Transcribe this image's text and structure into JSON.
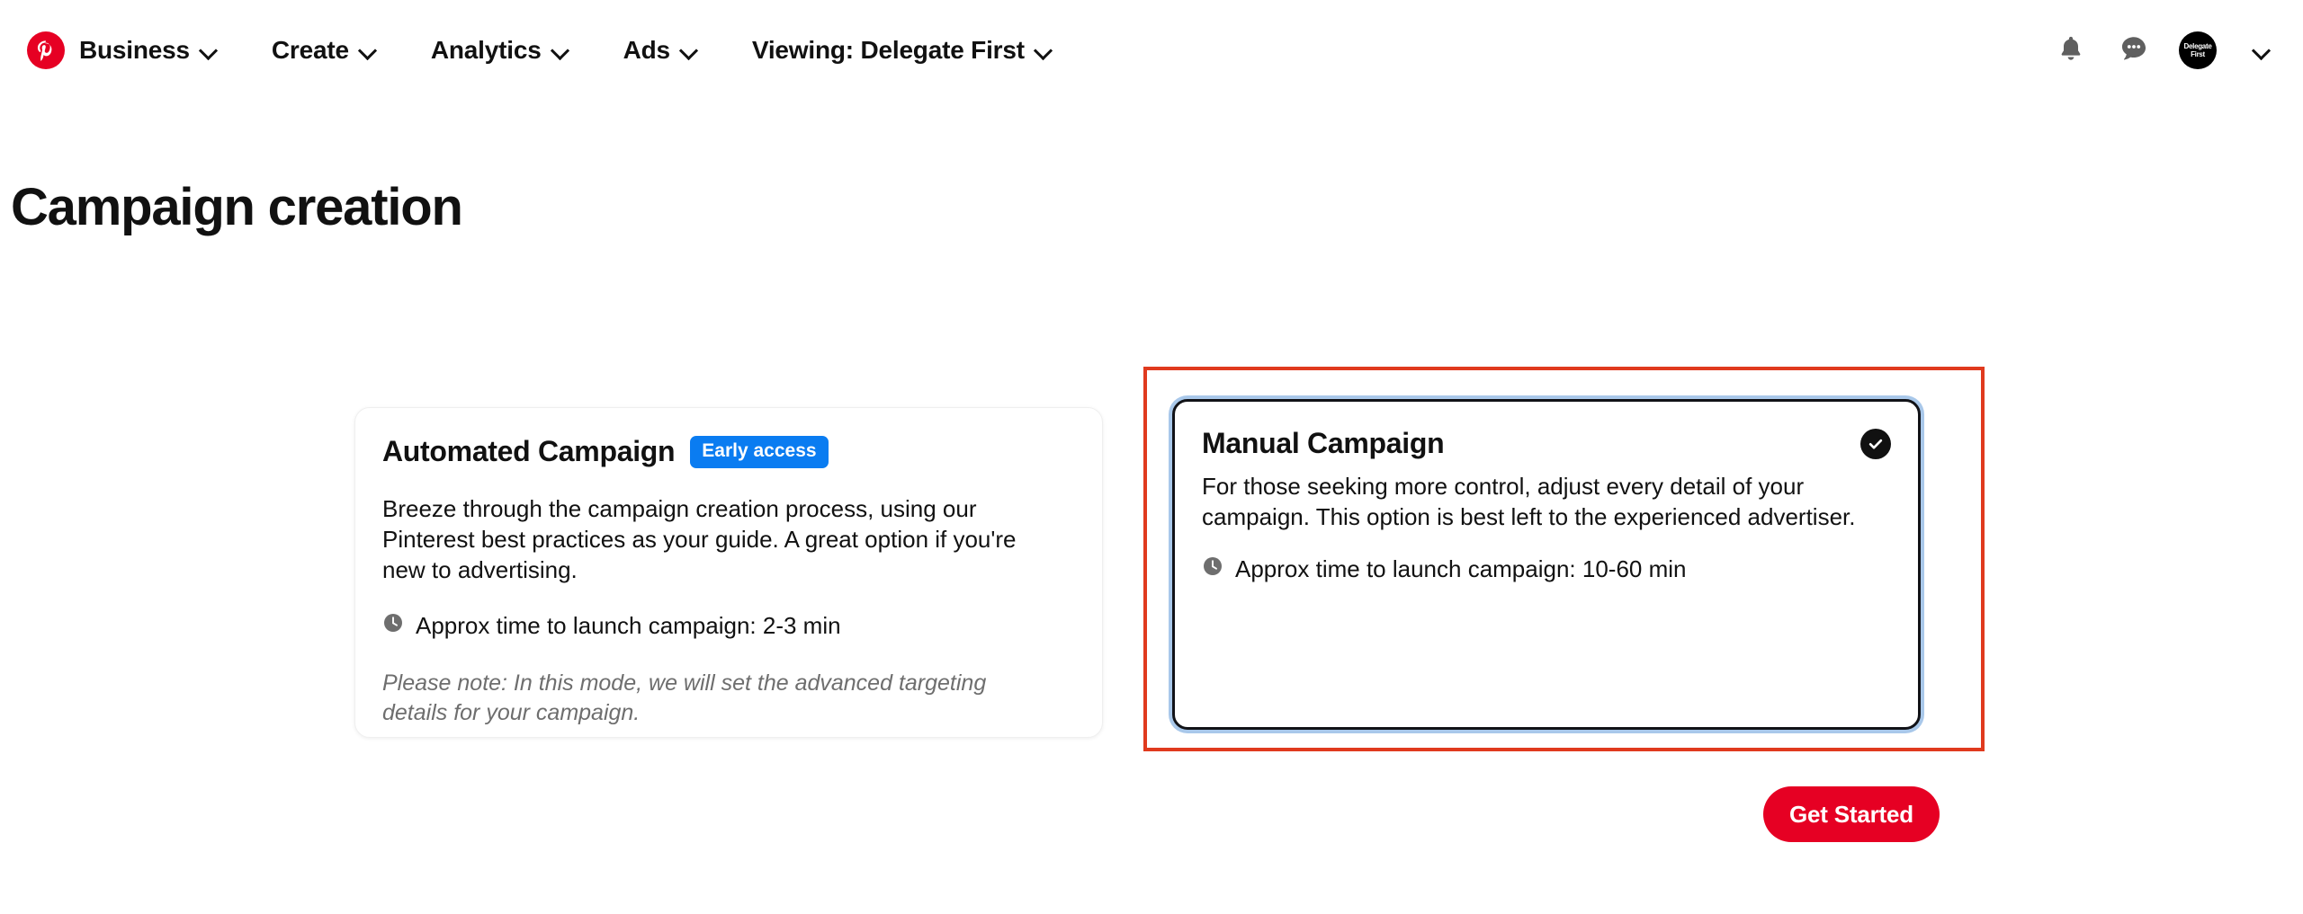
{
  "header": {
    "logo_icon": "pinterest-logo-icon",
    "nav": [
      {
        "label": "Business",
        "icon": "chevron-down-icon"
      },
      {
        "label": "Create",
        "icon": "chevron-down-icon"
      },
      {
        "label": "Analytics",
        "icon": "chevron-down-icon"
      },
      {
        "label": "Ads",
        "icon": "chevron-down-icon"
      },
      {
        "label": "Viewing: Delegate First",
        "icon": "chevron-down-icon"
      }
    ],
    "actions": {
      "notifications_icon": "bell-icon",
      "messages_icon": "chat-bubble-icon",
      "account_menu_icon": "chevron-down-icon"
    },
    "avatar": {
      "line1": "Delegate",
      "line2": "First"
    }
  },
  "page": {
    "title": "Campaign creation"
  },
  "cards": {
    "automated": {
      "title": "Automated Campaign",
      "badge": "Early access",
      "body": "Breeze through the campaign creation process, using our Pinterest best practices as your guide. A great option if you're new to advertising.",
      "time_icon": "clock-icon",
      "time": "Approx time to launch campaign: 2-3 min",
      "note": "Please note: In this mode, we will set the advanced targeting details for your campaign.",
      "selected": false
    },
    "manual": {
      "title": "Manual Campaign",
      "body": "For those seeking more control, adjust every detail of your campaign. This option is best left to the experienced advertiser.",
      "time_icon": "clock-icon",
      "time": "Approx time to launch campaign: 10-60 min",
      "selected": true,
      "selected_icon": "check-circle-icon"
    }
  },
  "footer": {
    "get_started_label": "Get Started"
  },
  "annotation": {
    "type": "highlight-rectangle",
    "target": "manual-campaign-card",
    "color": "#e03a1e"
  },
  "colors": {
    "brand_red": "#e60023",
    "badge_blue": "#0a7cf1",
    "annotation_red": "#e03a1e",
    "focus_ring_blue": "#a9c8ea",
    "text_primary": "#111111",
    "text_muted": "#6e6e6e"
  }
}
